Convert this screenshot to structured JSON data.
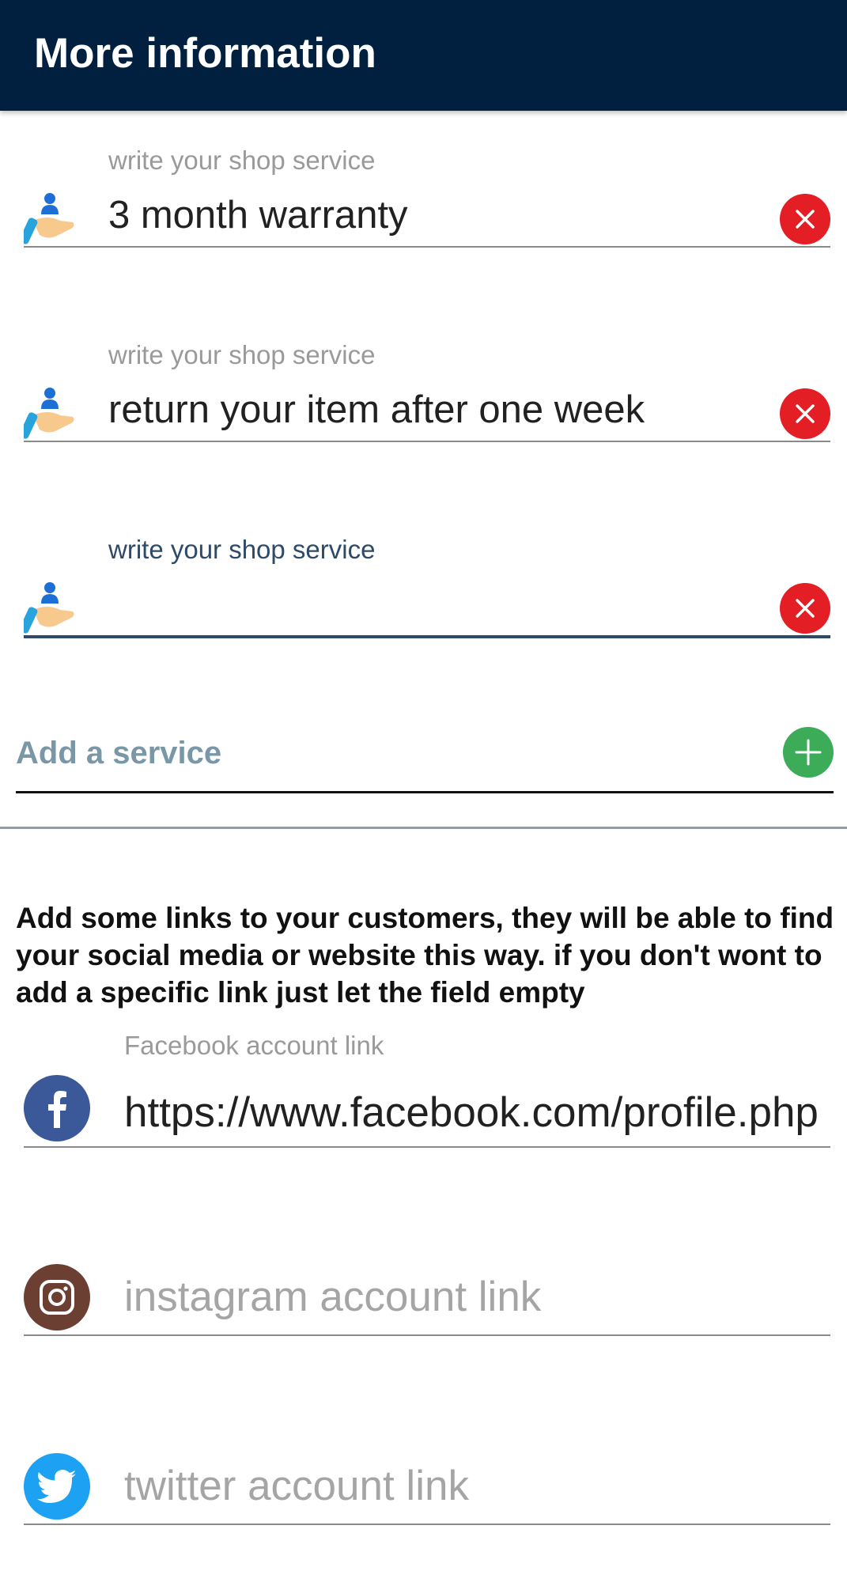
{
  "appbar": {
    "title": "More information"
  },
  "services": [
    {
      "label": "write your shop service",
      "value": "3 month warranty"
    },
    {
      "label": "write your shop service",
      "value": "return your item after one week"
    },
    {
      "label": "write your shop service",
      "value": ""
    }
  ],
  "add_service": {
    "label": "Add a service"
  },
  "links_info": "Add some links to your customers, they will be able to find your social media or website this way. if you don't wont to add a specific link just let the field empty",
  "links": {
    "facebook": {
      "label": "Facebook account link",
      "value": "https://www.facebook.com/profile.php"
    },
    "instagram": {
      "placeholder": "instagram account link"
    },
    "twitter": {
      "placeholder": "twitter account link"
    }
  },
  "colors": {
    "appbar": "#011f3f",
    "clear": "#e41e25",
    "add": "#3cac58",
    "facebook": "#3b5998",
    "instagram": "#6b4033",
    "twitter": "#1da1f2"
  },
  "icons": {
    "service": "hand-holding-user-icon",
    "clear": "close-icon",
    "add": "plus-icon",
    "facebook": "facebook-icon",
    "instagram": "instagram-icon",
    "twitter": "twitter-icon"
  }
}
